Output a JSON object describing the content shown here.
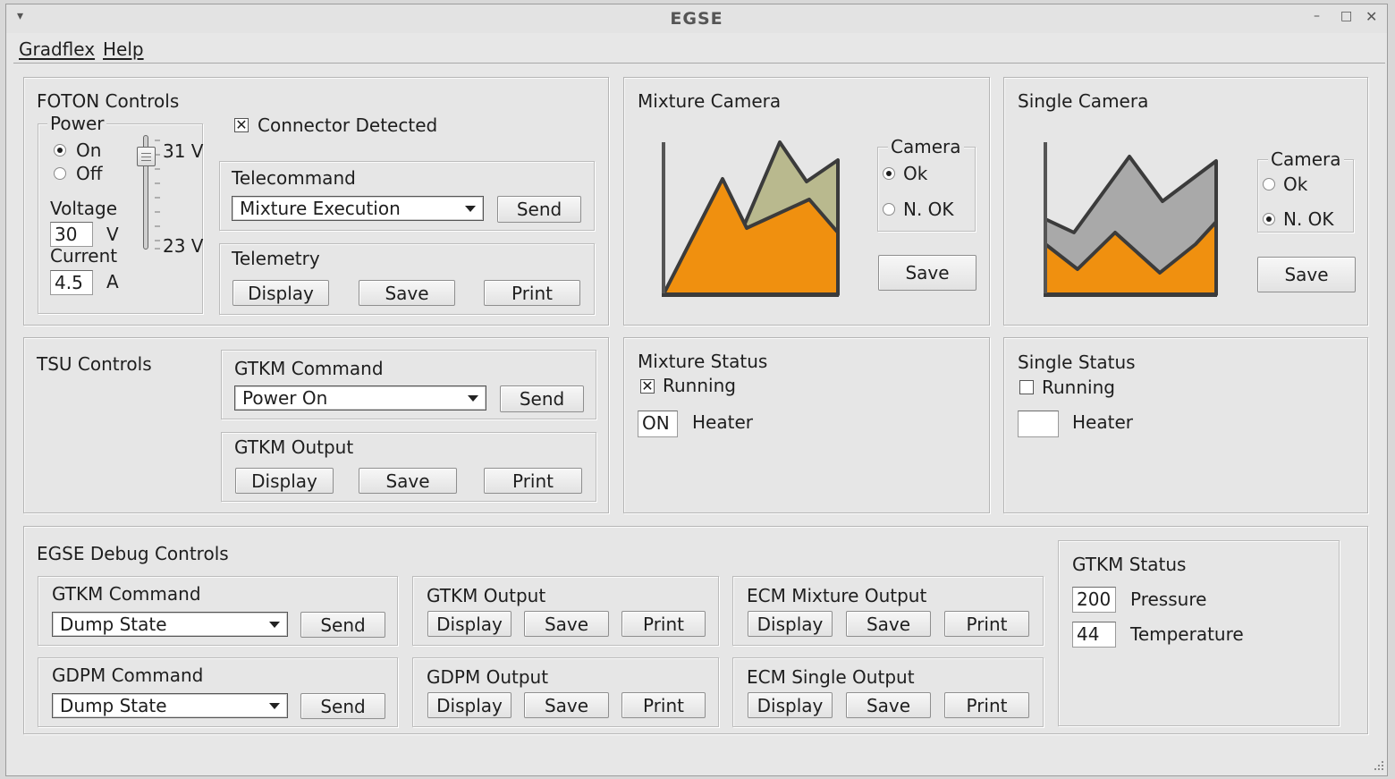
{
  "window": {
    "title": "EGSE"
  },
  "menu": {
    "items": [
      "Gradflex",
      "Help"
    ]
  },
  "foton": {
    "title": "FOTON Controls",
    "power": {
      "legend": "Power",
      "on_label": "On",
      "off_label": "Off",
      "selected": "On",
      "voltage_label": "Voltage",
      "voltage_value": "30",
      "voltage_unit": "V",
      "current_label": "Current",
      "current_value": "4.5",
      "current_unit": "A",
      "slider_max_label": "31 V",
      "slider_min_label": "23 V",
      "slider_level": 0.875
    },
    "connector": {
      "label": "Connector Detected",
      "checked": true
    },
    "telecommand": {
      "title": "Telecommand",
      "selected": "Mixture Execution",
      "send_label": "Send"
    },
    "telemetry": {
      "title": "Telemetry",
      "display_label": "Display",
      "save_label": "Save",
      "print_label": "Print"
    }
  },
  "mixture_camera": {
    "title": "Mixture Camera",
    "legend": "Camera",
    "ok_label": "Ok",
    "nok_label": "N. OK",
    "selected": "Ok",
    "save_label": "Save"
  },
  "single_camera": {
    "title": "Single Camera",
    "legend": "Camera",
    "ok_label": "Ok",
    "nok_label": "N. OK",
    "selected": "N. OK",
    "save_label": "Save"
  },
  "tsu": {
    "title": "TSU Controls",
    "gtkm_command": {
      "title": "GTKM Command",
      "selected": "Power On",
      "send_label": "Send"
    },
    "gtkm_output": {
      "title": "GTKM Output",
      "display_label": "Display",
      "save_label": "Save",
      "print_label": "Print"
    }
  },
  "mixture_status": {
    "title": "Mixture Status",
    "running_label": "Running",
    "running_checked": true,
    "heater_value": "ON",
    "heater_label": "Heater"
  },
  "single_status": {
    "title": "Single Status",
    "running_label": "Running",
    "running_checked": false,
    "heater_value": "",
    "heater_label": "Heater"
  },
  "debug": {
    "title": "EGSE Debug Controls",
    "gtkm_command": {
      "title": "GTKM Command",
      "selected": "Dump State",
      "send_label": "Send"
    },
    "gdpm_command": {
      "title": "GDPM Command",
      "selected": "Dump State",
      "send_label": "Send"
    },
    "gtkm_output": {
      "title": "GTKM Output",
      "display_label": "Display",
      "save_label": "Save",
      "print_label": "Print"
    },
    "gdpm_output": {
      "title": "GDPM Output",
      "display_label": "Display",
      "save_label": "Save",
      "print_label": "Print"
    },
    "ecm_mixture_output": {
      "title": "ECM Mixture Output",
      "display_label": "Display",
      "save_label": "Save",
      "print_label": "Print"
    },
    "ecm_single_output": {
      "title": "ECM Single Output",
      "display_label": "Display",
      "save_label": "Save",
      "print_label": "Print"
    }
  },
  "gtkm_status": {
    "title": "GTKM Status",
    "pressure_value": "200",
    "pressure_label": "Pressure",
    "temperature_value": "44",
    "temperature_label": "Temperature"
  },
  "icons": {
    "window_menu": "chevron-down-icon",
    "minimize": "minimize-icon",
    "maximize": "maximize-icon",
    "close": "close-icon",
    "mixture_camera_graphic": "area-chart-icon",
    "single_camera_graphic": "area-chart-icon"
  },
  "colors": {
    "orange": "#f0900f",
    "olive": "#b9b98e",
    "gray": "#a9a9a9",
    "outline": "#3b3b3b"
  }
}
